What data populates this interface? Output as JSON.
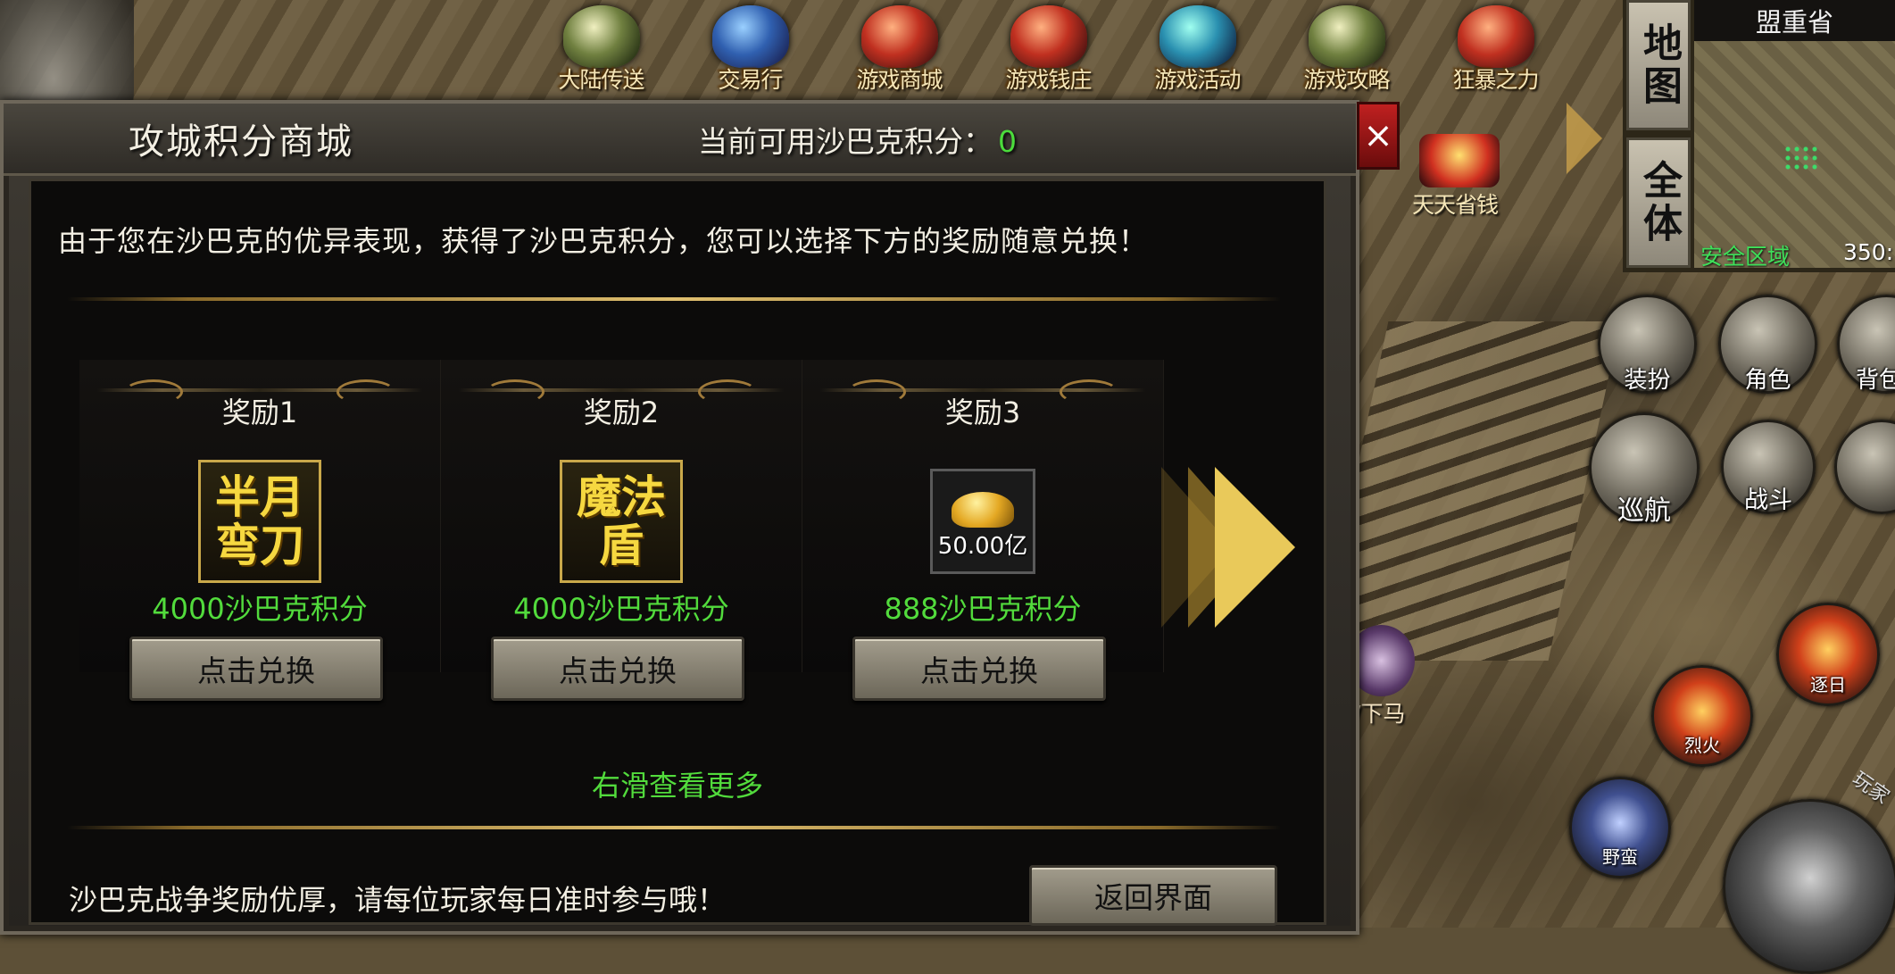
{
  "topbar": [
    {
      "label": "大陆传送",
      "icon": "teleport-icon"
    },
    {
      "label": "交易行",
      "icon": "trade-icon"
    },
    {
      "label": "游戏商城",
      "icon": "shop-chest-icon"
    },
    {
      "label": "游戏钱庄",
      "icon": "bank-chest-icon"
    },
    {
      "label": "游戏活动",
      "icon": "activity-icon"
    },
    {
      "label": "游戏攻略",
      "icon": "guide-icon"
    },
    {
      "label": "狂暴之力",
      "icon": "rage-icon"
    }
  ],
  "map": {
    "region": "盟重省",
    "tab_map": "地图",
    "tab_all": "全体",
    "zone": "安全区域",
    "coords": "350:"
  },
  "side": {
    "daily": "天天省钱",
    "mount": "/下马",
    "buttons": [
      "装扮",
      "角色",
      "背包"
    ],
    "cruise": "巡航",
    "battle": "战斗"
  },
  "skills": [
    "逐日",
    "烈火",
    "野蛮",
    "玩家"
  ],
  "panel": {
    "title": "攻城积分商城",
    "points_label": "当前可用沙巴克积分：",
    "points_value": "0",
    "close": "×",
    "intro": "由于您在沙巴克的优异表现，获得了沙巴克积分，您可以选择下方的奖励随意兑换！",
    "rewards": [
      {
        "name": "奖励1",
        "item": "半月\n弯刀",
        "cost": "4000沙巴克积分",
        "button": "点击兑换"
      },
      {
        "name": "奖励2",
        "item": "魔法\n盾",
        "cost": "4000沙巴克积分",
        "button": "点击兑换"
      },
      {
        "name": "奖励3",
        "item_qty": "50.00亿",
        "cost": "888沙巴克积分",
        "button": "点击兑换"
      }
    ],
    "swipe_hint": "右滑查看更多",
    "footer": "沙巴克战争奖励优厚，请每位玩家每日准时参与哦！",
    "back_button": "返回界面"
  }
}
